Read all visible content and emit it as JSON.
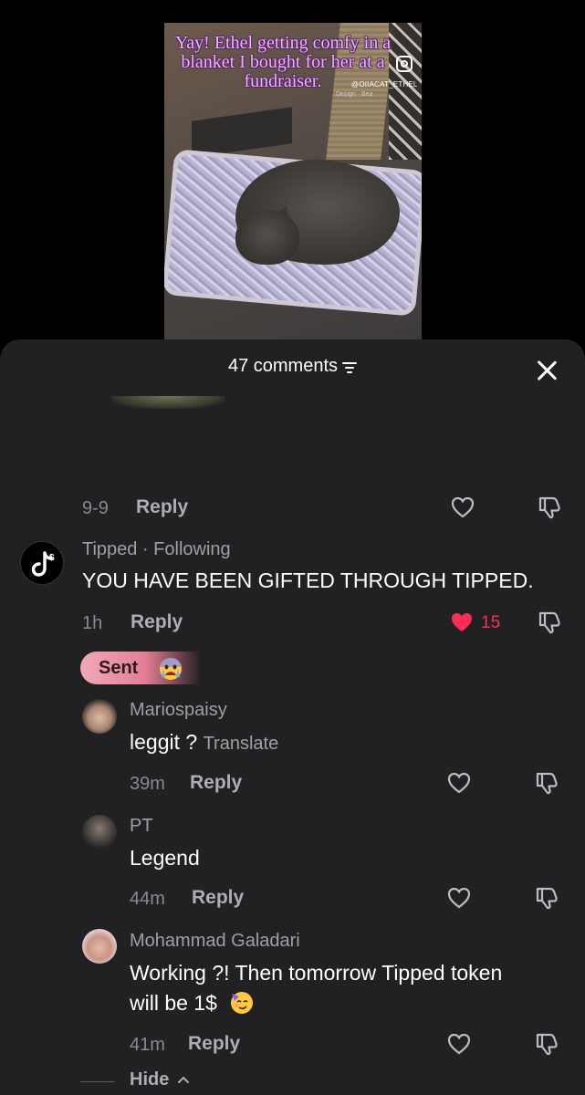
{
  "video": {
    "overlay_text": "Yay! Ethel getting comfy in a blanket I bought for her at a fundraiser.",
    "handle": "@OIIACAT_ETHEL",
    "design_credit": "Design · Bea"
  },
  "sheet": {
    "title": "47 comments",
    "close_icon": "close-icon",
    "filter_icon": "filter-icon"
  },
  "prev_comment": {
    "time": "9-9",
    "reply_label": "Reply"
  },
  "comments": [
    {
      "username": "Tipped · Following",
      "text": "YOU HAVE BEEN GIFTED THROUGH TIPPED.",
      "time": "1h",
      "reply_label": "Reply",
      "likes": "15",
      "liked": true
    }
  ],
  "sent_badge": {
    "label": "Sent",
    "emoji": "crying-emoji"
  },
  "replies": [
    {
      "username": "Mariospaisy",
      "text": "leggit ?",
      "translate": "Translate",
      "time": "39m",
      "reply_label": "Reply"
    },
    {
      "username": "PT",
      "text": "Legend",
      "time": "44m",
      "reply_label": "Reply"
    },
    {
      "username": "Mohammad Galadari",
      "text_line1": "Working ?! Then tomorrow Tipped token",
      "text_line2": "will be 1$",
      "emoji": "partying-face-emoji",
      "time": "41m",
      "reply_label": "Reply"
    }
  ],
  "hide_label": "Hide",
  "colors": {
    "sheet_bg": "#212123",
    "like_red": "#fe2c55",
    "overlay_purple": "#e7b8f5"
  }
}
